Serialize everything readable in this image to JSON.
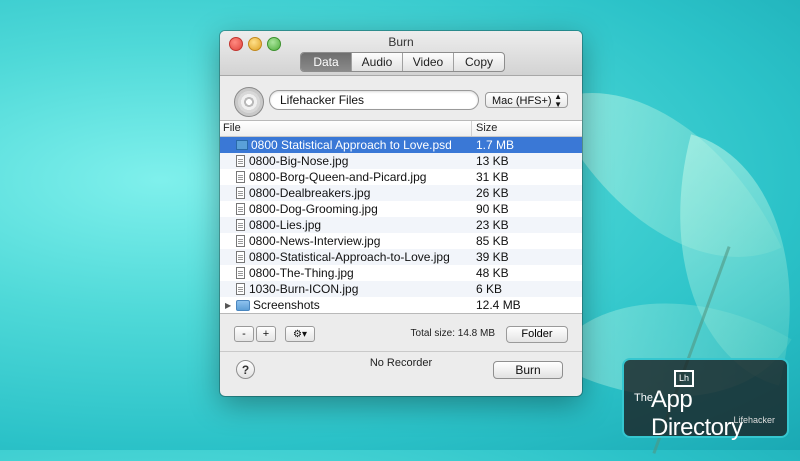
{
  "window": {
    "title": "Burn",
    "tabs": [
      "Data",
      "Audio",
      "Video",
      "Copy"
    ],
    "active_tab": "Data"
  },
  "disc": {
    "name": "Lifehacker Files",
    "filesystem": "Mac (HFS+)"
  },
  "table": {
    "columns": {
      "file": "File",
      "size": "Size"
    },
    "rows": [
      {
        "name": "0800 Statistical Approach to Love.psd",
        "size": "1.7 MB",
        "icon": "psd-file-icon",
        "selected": true
      },
      {
        "name": "0800-Big-Nose.jpg",
        "size": "13 KB",
        "icon": "image-file-icon"
      },
      {
        "name": "0800-Borg-Queen-and-Picard.jpg",
        "size": "31 KB",
        "icon": "image-file-icon"
      },
      {
        "name": "0800-Dealbreakers.jpg",
        "size": "26 KB",
        "icon": "image-file-icon"
      },
      {
        "name": "0800-Dog-Grooming.jpg",
        "size": "90 KB",
        "icon": "image-file-icon"
      },
      {
        "name": "0800-Lies.jpg",
        "size": "23 KB",
        "icon": "image-file-icon"
      },
      {
        "name": "0800-News-Interview.jpg",
        "size": "85 KB",
        "icon": "image-file-icon"
      },
      {
        "name": "0800-Statistical-Approach-to-Love.jpg",
        "size": "39 KB",
        "icon": "image-file-icon"
      },
      {
        "name": "0800-The-Thing.jpg",
        "size": "48 KB",
        "icon": "image-file-icon"
      },
      {
        "name": "1030-Burn-ICON.jpg",
        "size": "6 KB",
        "icon": "image-file-icon"
      },
      {
        "name": "Screenshots",
        "size": "12.4 MB",
        "icon": "folder-icon",
        "folder": true
      }
    ]
  },
  "controls": {
    "minus": "-",
    "plus": "+",
    "gear": "⚙▾",
    "total_size": "Total size: 14.8 MB",
    "folder_button": "Folder",
    "recorder_status": "No Recorder",
    "burn_button": "Burn",
    "help": "?"
  },
  "badge": {
    "the": "The",
    "title": "App Directory",
    "brand": "Lifehacker",
    "logo": "Lh"
  },
  "colors": {
    "selection": "#3a78d6",
    "background_accent": "#3ccfd2",
    "badge_border": "#35c6cf"
  }
}
